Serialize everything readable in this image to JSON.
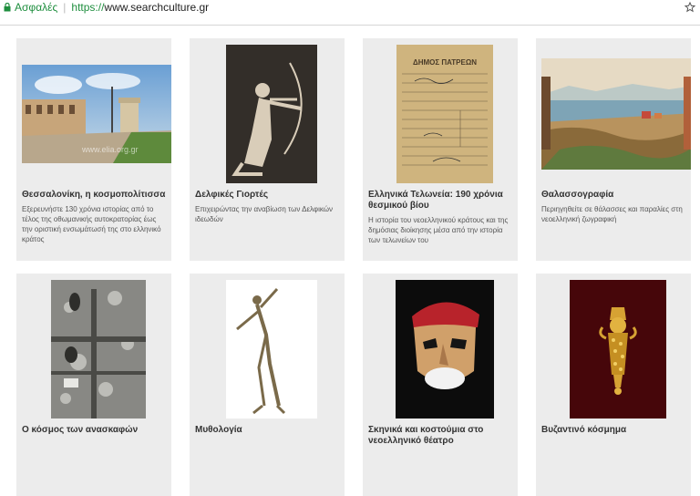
{
  "browser": {
    "secure_label": "Ασφαλές",
    "url_scheme": "https://",
    "url_host": "www.searchculture.gr",
    "lock_icon": "lock-icon",
    "star_icon": "bookmark-star-icon"
  },
  "cards": [
    {
      "title": "Θεσσαλονίκη, η κοσμοπολίτισσα",
      "description": "Εξερευνήστε 130 χρόνια ιστορίας από το τέλος της οθωμανικής αυτοκρατορίας έως την οριστική ενσωμάτωσή της στο ελληνικό κράτος",
      "thumb_watermark": "www.elia.org.gr"
    },
    {
      "title": "Δελφικές Γιορτές",
      "description": "Επιχειρώντας την αναβίωση των Δελφικών ιδεωδών"
    },
    {
      "title": "Ελληνικά Τελωνεία: 190 χρόνια θεσμικού βίου",
      "description": "Η ιστορία του νεοελληνικού κράτους και της δημόσιας διοίκησης μέσα από την ιστορία των τελωνείων του",
      "thumb_heading": "ΔΗΜΟΣ ΠΑΤΡΕΩΝ"
    },
    {
      "title": "Θαλασσογραφία",
      "description": "Περιηγηθείτε σε θάλασσες και παραλίες στη νεοελληνική ζωγραφική"
    },
    {
      "title": "Ο κόσμος των ανασκαφών",
      "description": ""
    },
    {
      "title": "Μυθολογία",
      "description": ""
    },
    {
      "title": "Σκηνικά και κοστούμια στο νεοελληνικό θέατρο",
      "description": ""
    },
    {
      "title": "Βυζαντινό κόσμημα",
      "description": ""
    }
  ]
}
